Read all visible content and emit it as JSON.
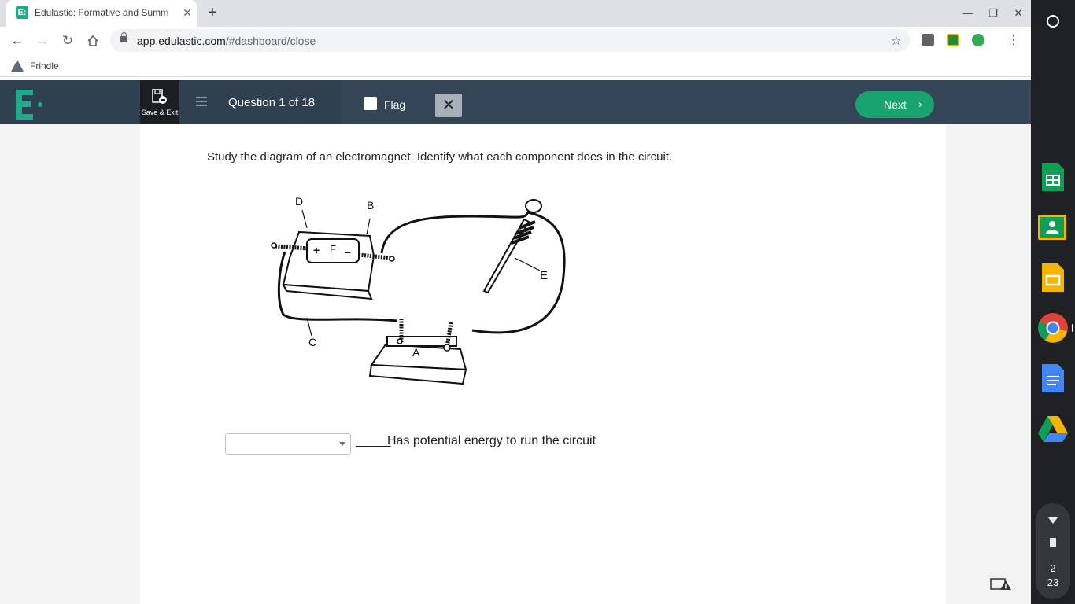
{
  "browser": {
    "tab_title": "Edulastic: Formative and Summ",
    "tab_favicon": "E:",
    "url_host": "app.edulastic.com",
    "url_path": "/#dashboard/close",
    "bookmark_label": "Frindle"
  },
  "header": {
    "save_exit_label": "Save & Exit",
    "question_label": "Question 1 of 18",
    "flag_label": "Flag",
    "next_label": "Next"
  },
  "question": {
    "prompt": "Study the diagram of an electromagnet. Identify what each component does in the circuit.",
    "diagram_labels": {
      "D": "D",
      "B": "B",
      "F": "F",
      "plus": "+",
      "minus": "–",
      "E": "E",
      "C": "C",
      "A": "A"
    },
    "dropdown_value": "",
    "blank": "_____",
    "answer_text": "Has potential energy to run the circuit"
  },
  "shelf": {
    "clock_hour": "2",
    "clock_minute": "23",
    "apps": [
      "google-sheets",
      "google-classroom",
      "google-slides",
      "google-chrome",
      "google-docs",
      "google-drive"
    ]
  },
  "colors": {
    "header_bg": "#2f4151",
    "accent_green": "#1aa36f",
    "logo_green": "#1fab89"
  }
}
